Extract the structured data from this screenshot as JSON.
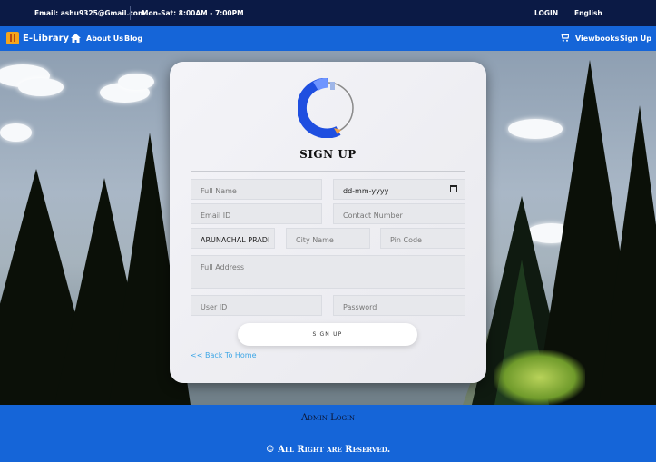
{
  "topbar": {
    "email": "Email: ashu9325@Gmail.com",
    "hours": "Mon-Sat: 8:00AM - 7:00PM",
    "login": "LOGIN",
    "language": "English"
  },
  "nav": {
    "brand": "E-Library",
    "about": "About Us",
    "blog": "Blog",
    "viewbooks": "Viewbooks",
    "signup": "Sign Up"
  },
  "form": {
    "title": "SIGN UP",
    "full_name_placeholder": "Full Name",
    "dob_value": "dd-mm-yyyy",
    "email_placeholder": "Email ID",
    "contact_placeholder": "Contact Number",
    "state_value": "ARUNACHAL PRADI",
    "city_placeholder": "City Name",
    "pin_placeholder": "Pin Code",
    "address_placeholder": "Full Address",
    "userid_placeholder": "User ID",
    "password_placeholder": "Password",
    "submit_label": "SIGN UP",
    "back_link": "<< Back To Home"
  },
  "footer": {
    "admin_login": "Admin Login",
    "rights": "© All Right are Reserved."
  },
  "colors": {
    "topbar_bg": "#0b1a45",
    "nav_bg": "#1565d8",
    "link": "#3ea6e6",
    "logo_blue": "#1f4fe0"
  }
}
